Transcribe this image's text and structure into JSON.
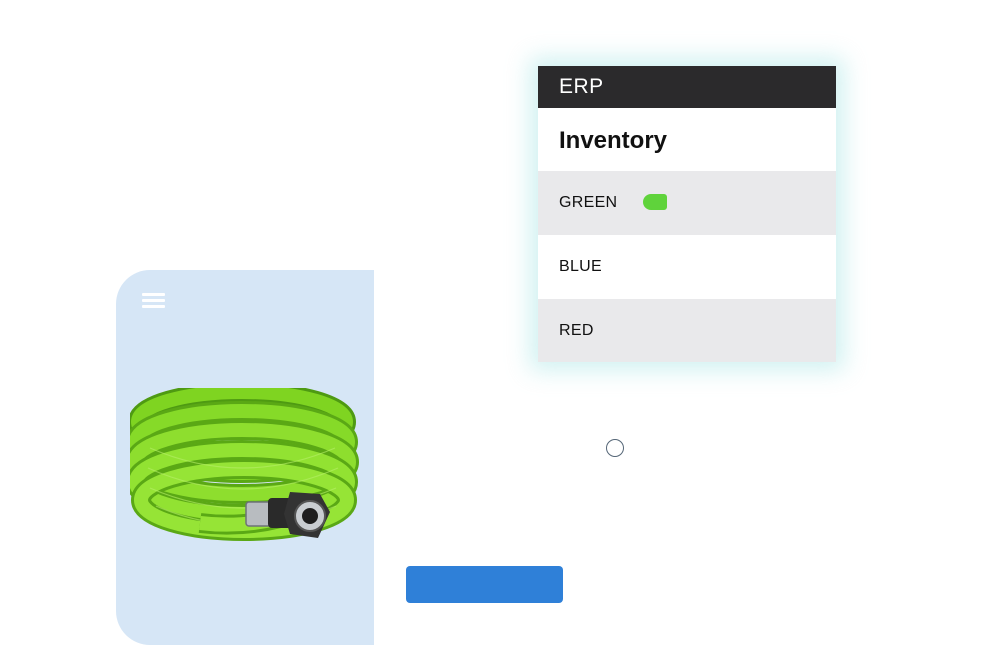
{
  "erp": {
    "header": "ERP",
    "title": "Inventory",
    "rows": [
      {
        "label": "GREEN",
        "toggle_on": true
      },
      {
        "label": "BLUE"
      },
      {
        "label": "RED"
      }
    ]
  },
  "product": {
    "menu_icon": "hamburger-menu-icon",
    "image": "green-garden-hose"
  },
  "colors": {
    "erp_header_bg": "#2b2a2c",
    "row_alt_bg": "#e9e9eb",
    "toggle_green": "#5fd33b",
    "card_bg": "#d6e6f6",
    "button_blue": "#2f80d8"
  }
}
